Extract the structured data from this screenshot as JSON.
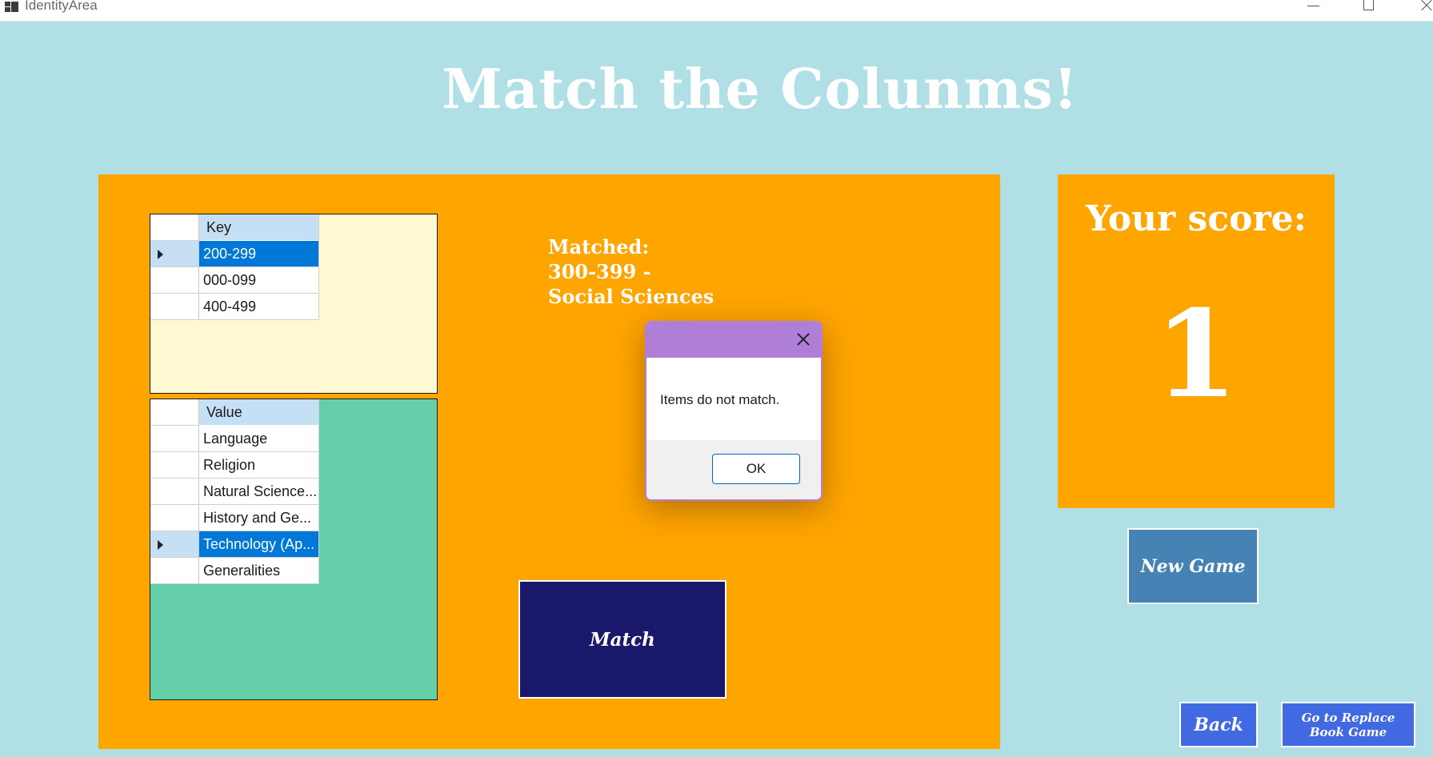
{
  "window": {
    "title": "IdentityArea"
  },
  "heading": "Match the Colunms!",
  "key_grid": {
    "header": "Key",
    "rows": [
      "200-299",
      "000-099",
      "400-499"
    ],
    "selected_index": 0
  },
  "value_grid": {
    "header": "Value",
    "rows": [
      "Language",
      "Religion",
      "Natural Science...",
      "History and Ge...",
      "Technology (Ap...",
      "Generalities"
    ],
    "selected_index": 4
  },
  "matched": {
    "label": "Matched:",
    "key": "300-399 -",
    "value": "Social Sciences"
  },
  "buttons": {
    "match": "Match",
    "new_game": "New Game",
    "back": "Back",
    "replace_line1": "Go to Replace",
    "replace_line2": "Book Game"
  },
  "score": {
    "label": "Your score:",
    "value": "1"
  },
  "dialog": {
    "message": "Items do not match.",
    "ok": "OK"
  },
  "colors": {
    "background": "#b0dfe5",
    "panel": "#ffa500",
    "match_button": "#1a186b",
    "new_game_button": "#4682b4",
    "nav_button": "#4169e1",
    "selection": "#0078d7",
    "dialog_title": "#af7fd8"
  }
}
